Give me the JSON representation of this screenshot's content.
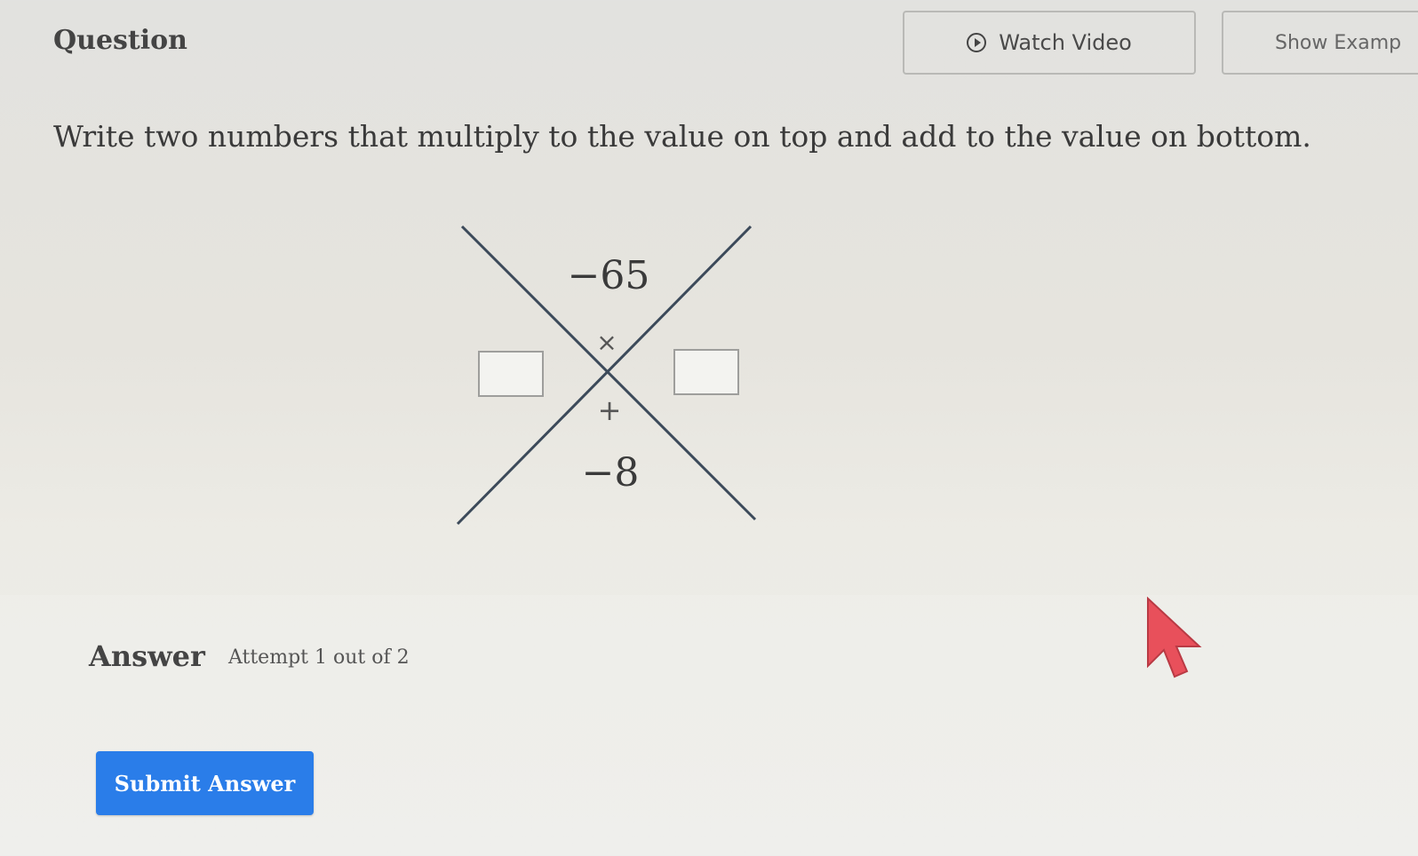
{
  "header": {
    "question_label": "Question",
    "watch_video_label": "Watch Video",
    "show_example_label": "Show Examp"
  },
  "instruction": "Write two numbers that multiply to the value on top and add to the value on bottom.",
  "diagram": {
    "top_value": "−65",
    "multiply_symbol": "×",
    "plus_symbol": "+",
    "bottom_value": "−8",
    "left_input_value": "",
    "right_input_value": ""
  },
  "answer": {
    "label": "Answer",
    "attempt_text": "Attempt 1 out of 2",
    "submit_label": "Submit Answer"
  },
  "colors": {
    "submit_button": "#2a7de9",
    "cursor": "#e8505b"
  }
}
